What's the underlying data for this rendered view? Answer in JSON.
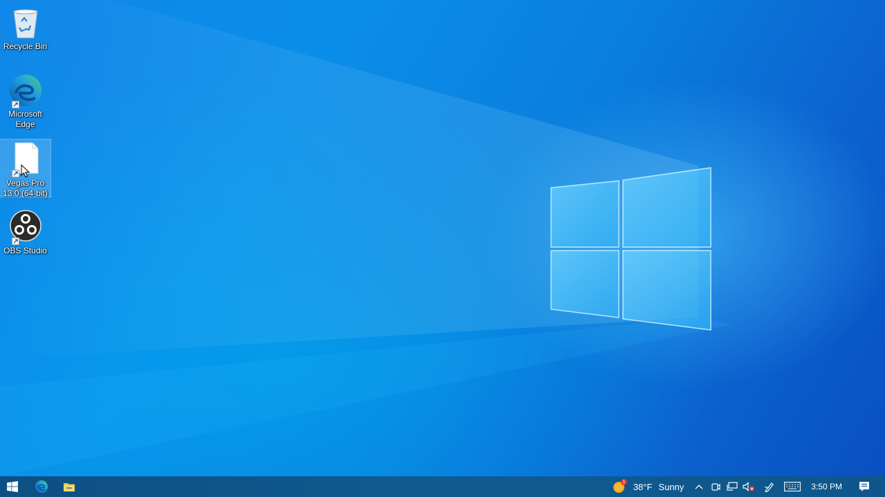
{
  "desktop": {
    "icons": [
      {
        "label": "Recycle Bin",
        "icon": "recycle-bin-icon"
      },
      {
        "label": "Microsoft Edge",
        "icon": "edge-icon"
      },
      {
        "label": "Vegas Pro 13.0 (64-bit)",
        "icon": "document-icon"
      },
      {
        "label": "OBS Studio",
        "icon": "obs-icon"
      }
    ],
    "selected_icon": "Vegas Pro 13.0 (64-bit)"
  },
  "taskbar": {
    "pinned": [
      "start-windows-icon",
      "edge-icon",
      "file-explorer-icon"
    ],
    "weather": {
      "temperature": "38°F",
      "condition": "Sunny",
      "badge": "1"
    },
    "tray_icons": [
      "chevron-up-icon",
      "meet-now-icon",
      "network-icon",
      "volume-muted-icon",
      "pen-icon",
      "keyboard-icon"
    ],
    "clock": "3:50 PM",
    "notifications_icon": "action-center-icon"
  },
  "colors": {
    "accent": "#0a78d7",
    "taskbar": "#0f5a8e"
  }
}
